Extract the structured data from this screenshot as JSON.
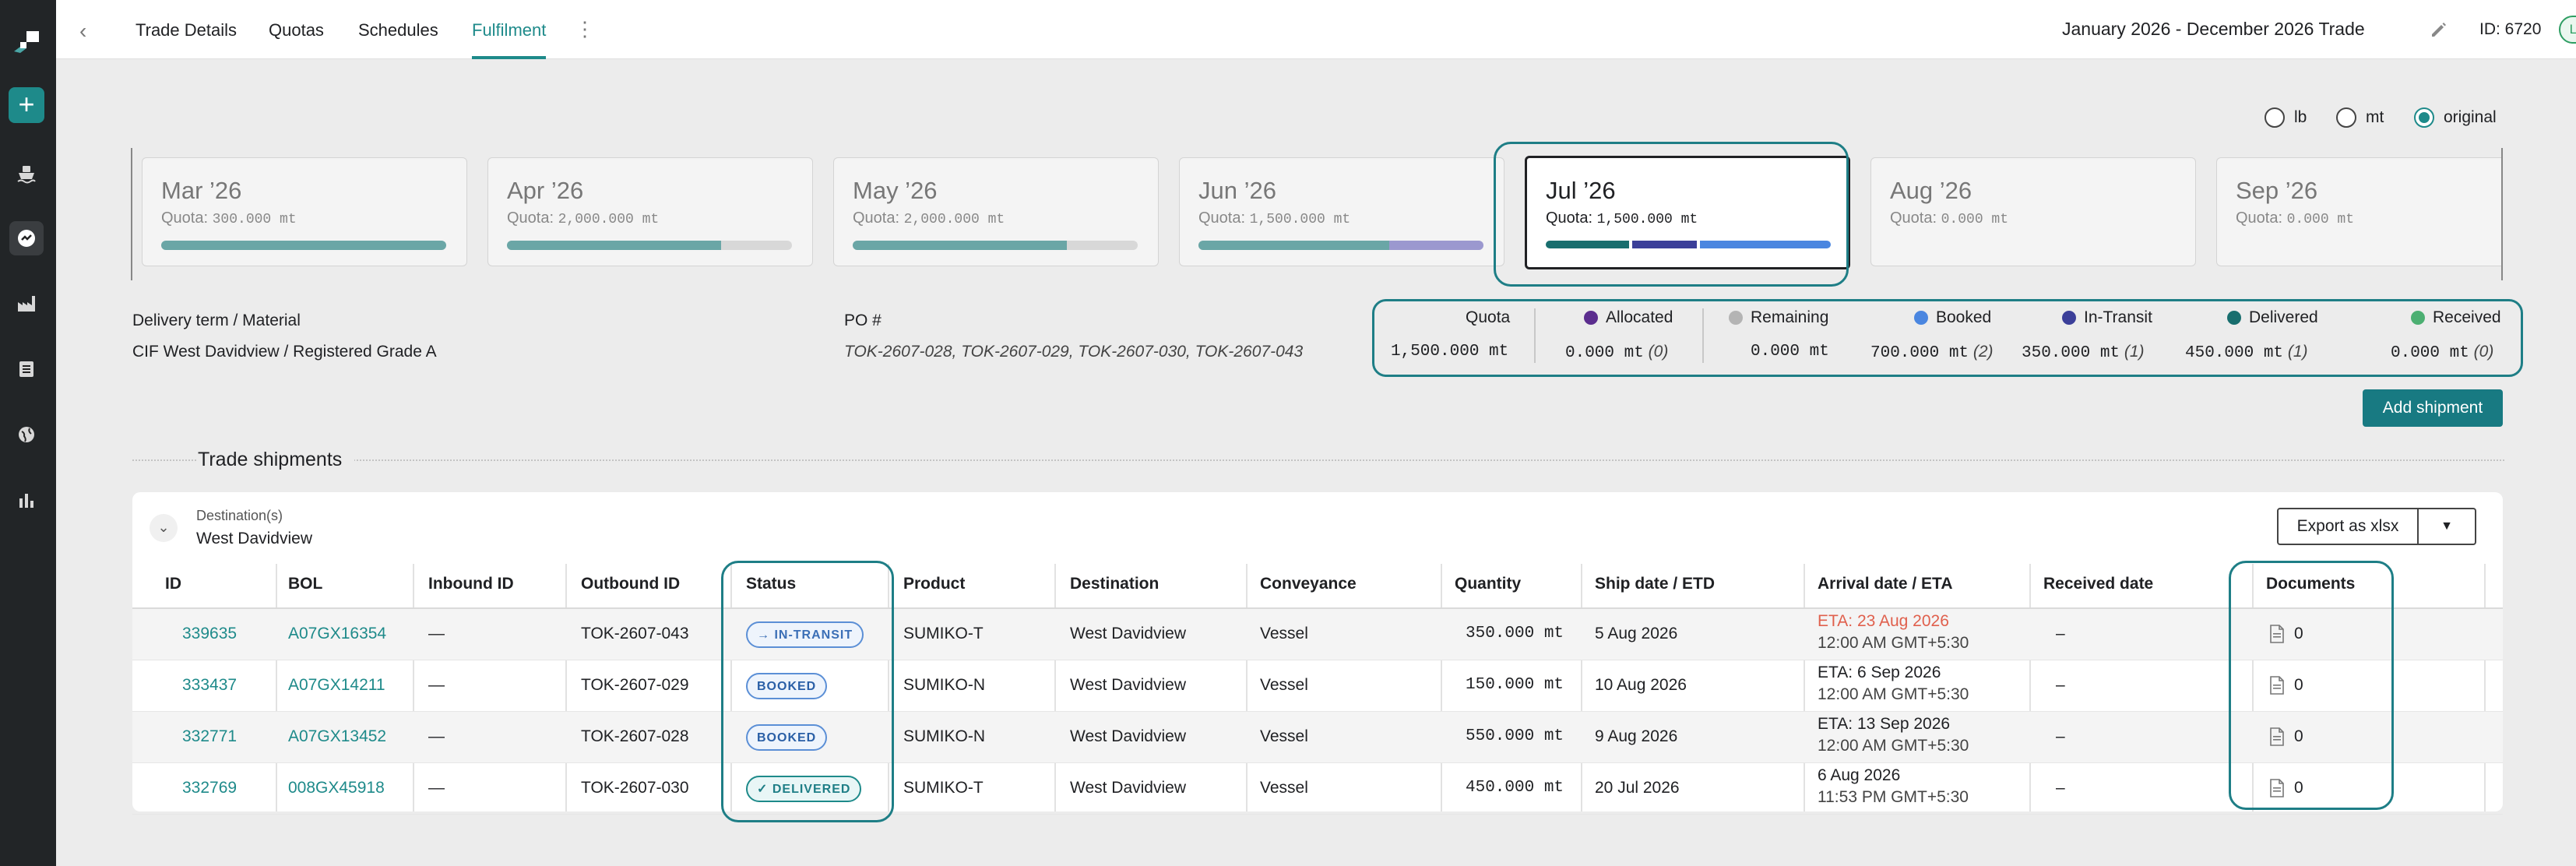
{
  "header": {
    "tabs": [
      {
        "label": "Trade Details"
      },
      {
        "label": "Quotas"
      },
      {
        "label": "Schedules"
      },
      {
        "label": "Fulfilment",
        "active": true
      }
    ],
    "title": "January 2026 - December 2026 Trade",
    "id_text": "ID: 6720",
    "status": "LIVE"
  },
  "units": {
    "options": [
      "lb",
      "mt",
      "original"
    ],
    "selected": "original"
  },
  "months": [
    {
      "name": "Mar ’26",
      "quota_label": "Quota:",
      "quota": "300.000 mt",
      "fill": [
        {
          "color": "#6aa6a6",
          "pct": 100
        }
      ]
    },
    {
      "name": "Apr ’26",
      "quota_label": "Quota:",
      "quota": "2,000.000 mt",
      "fill": [
        {
          "color": "#6aa6a6",
          "pct": 75
        }
      ]
    },
    {
      "name": "May ’26",
      "quota_label": "Quota:",
      "quota": "2,000.000 mt",
      "fill": [
        {
          "color": "#6aa6a6",
          "pct": 75
        }
      ]
    },
    {
      "name": "Jun ’26",
      "quota_label": "Quota:",
      "quota": "1,500.000 mt",
      "fill": [
        {
          "color": "#6aa6a6",
          "pct": 67
        },
        {
          "color": "#9b98cf",
          "pct": 33
        }
      ]
    },
    {
      "name": "Jul ’26",
      "quota_label": "Quota:",
      "quota": "1,500.000 mt",
      "selected": true,
      "fill": [
        {
          "color": "#186e6e",
          "pct": 30
        },
        {
          "color": "#3b3f99",
          "pct": 23
        },
        {
          "color": "#4a86e0",
          "pct": 47
        }
      ]
    },
    {
      "name": "Aug ’26",
      "quota_label": "Quota:",
      "quota": "0.000 mt",
      "fill": []
    },
    {
      "name": "Sep ’26",
      "quota_label": "Quota:",
      "quota": "0.000 mt",
      "fill": []
    }
  ],
  "info": {
    "delivery_label": "Delivery term / Material",
    "delivery_value": "CIF West Davidview / Registered Grade A",
    "po_label": "PO #",
    "po_value": "TOK-2607-028, TOK-2607-029, TOK-2607-030, TOK-2607-043"
  },
  "stats": {
    "quota": {
      "label": "Quota",
      "value": "1,500.000 mt"
    },
    "allocated": {
      "label": "Allocated",
      "value": "0.000 mt",
      "count": "(0)",
      "color": "#5b2d8e"
    },
    "remaining": {
      "label": "Remaining",
      "value": "0.000 mt",
      "color": "#b4b4b4"
    },
    "booked": {
      "label": "Booked",
      "value": "700.000 mt",
      "count": "(2)",
      "color": "#4a86e0"
    },
    "in_transit": {
      "label": "In-Transit",
      "value": "350.000 mt",
      "count": "(1)",
      "color": "#3b3f99"
    },
    "delivered": {
      "label": "Delivered",
      "value": "450.000 mt",
      "count": "(1)",
      "color": "#186e6e"
    },
    "received": {
      "label": "Received",
      "value": "0.000 mt",
      "count": "(0)",
      "color": "#4caf72"
    }
  },
  "add_shipment_label": "Add shipment",
  "section_title": "Trade shipments",
  "shipments": {
    "destination_label": "Destination(s)",
    "destination_value": "West Davidview",
    "export_label": "Export as xlsx",
    "columns": [
      "ID",
      "BOL",
      "Inbound ID",
      "Outbound ID",
      "Status",
      "Product",
      "Destination",
      "Conveyance",
      "Quantity",
      "Ship date / ETD",
      "Arrival date / ETA",
      "Received date",
      "Documents"
    ],
    "rows": [
      {
        "id": "339635",
        "bol": "A07GX16354",
        "inbound": "—",
        "outbound": "TOK-2607-043",
        "status": "→ IN-TRANSIT",
        "status_kind": "transit",
        "product": "SUMIKO-T",
        "destination": "West Davidview",
        "conveyance": "Vessel",
        "quantity": "350.000 mt",
        "ship_date": "5 Aug 2026",
        "arrival_main": "ETA: 23 Aug 2026",
        "arrival_late": true,
        "arrival_sub": "12:00 AM GMT+5:30",
        "received": "–",
        "docs": "0"
      },
      {
        "id": "333437",
        "bol": "A07GX14211",
        "inbound": "—",
        "outbound": "TOK-2607-029",
        "status": "BOOKED",
        "status_kind": "booked",
        "product": "SUMIKO-N",
        "destination": "West Davidview",
        "conveyance": "Vessel",
        "quantity": "150.000 mt",
        "ship_date": "10 Aug 2026",
        "arrival_main": "ETA: 6 Sep 2026",
        "arrival_late": false,
        "arrival_sub": "12:00 AM GMT+5:30",
        "received": "–",
        "docs": "0"
      },
      {
        "id": "332771",
        "bol": "A07GX13452",
        "inbound": "—",
        "outbound": "TOK-2607-028",
        "status": "BOOKED",
        "status_kind": "booked",
        "product": "SUMIKO-N",
        "destination": "West Davidview",
        "conveyance": "Vessel",
        "quantity": "550.000 mt",
        "ship_date": "9 Aug 2026",
        "arrival_main": "ETA: 13 Sep 2026",
        "arrival_late": false,
        "arrival_sub": "12:00 AM GMT+5:30",
        "received": "–",
        "docs": "0"
      },
      {
        "id": "332769",
        "bol": "008GX45918",
        "inbound": "—",
        "outbound": "TOK-2607-030",
        "status": "✓ DELIVERED",
        "status_kind": "delivered",
        "product": "SUMIKO-T",
        "destination": "West Davidview",
        "conveyance": "Vessel",
        "quantity": "450.000 mt",
        "ship_date": "20 Jul 2026",
        "arrival_main": "6 Aug 2026",
        "arrival_late": false,
        "arrival_sub": "11:53 PM GMT+5:30",
        "received": "–",
        "docs": "0"
      }
    ]
  }
}
